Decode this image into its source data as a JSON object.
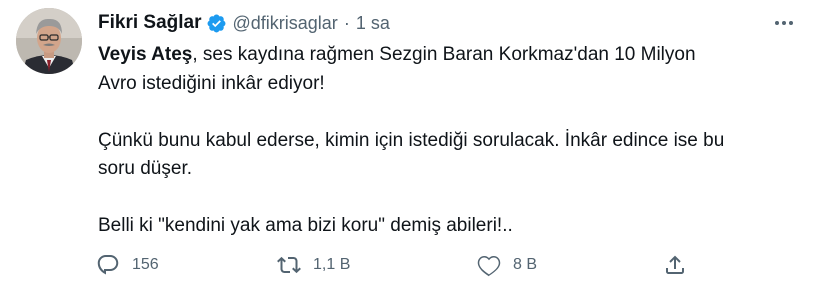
{
  "author": {
    "name": "Fikri Sağlar",
    "handle": "@dfikrisaglar",
    "separator": "·",
    "time": "1 sa",
    "verified": true
  },
  "tweet": {
    "mention": "Veyis Ateş",
    "line1_rest": ", ses kaydına rağmen Sezgin Baran Korkmaz'dan 10 Milyon",
    "line2": "Avro istediğini inkâr ediyor!",
    "line3": "Çünkü bunu kabul ederse, kimin için istediği sorulacak. İnkâr edince ise bu",
    "line4": "soru düşer.",
    "line5": "Belli ki \"kendini yak ama bizi koru\" demiş abileri!.."
  },
  "actions": {
    "reply_count": "156",
    "retweet_count": "1,1 B",
    "like_count": "8 B"
  },
  "icons": {
    "verified": "verified-badge-icon",
    "more": "more-options-icon",
    "reply": "reply-icon",
    "retweet": "retweet-icon",
    "like": "heart-icon",
    "share": "share-icon"
  },
  "colors": {
    "text": "#0f1419",
    "secondary": "#536471",
    "verified_blue": "#1d9bf0"
  }
}
